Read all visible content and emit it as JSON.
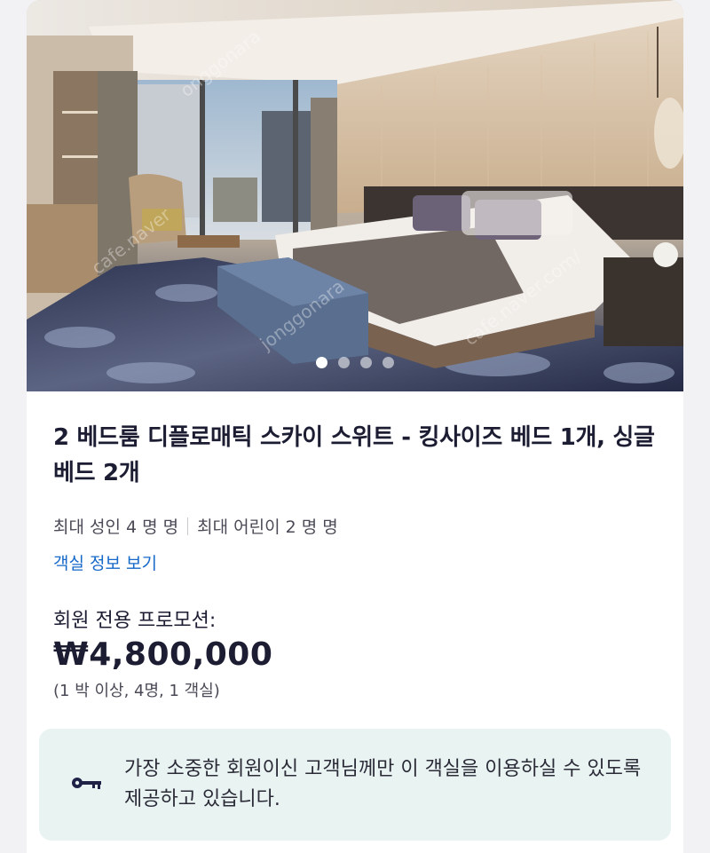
{
  "gallery": {
    "image_alt": "hotel-room-photo",
    "page_dots": 4,
    "active_index": 0
  },
  "room": {
    "title": "2 베드룸 디플로매틱 스카이 스위트 - 킹사이즈 베드 1개, 싱글 베드 2개",
    "max_adults": "최대 성인 4 명 명",
    "max_children": "최대 어린이 2 명 명",
    "details_link": "객실 정보 보기"
  },
  "pricing": {
    "promo_label": "회원 전용 프로모션:",
    "price": "₩4,800,000",
    "note": "(1 박 이상, 4명, 1 객실)"
  },
  "notice": {
    "icon": "key-icon",
    "text": "가장 소중한 회원이신 고객님께만 이 객실을 이용하실 수 있도록 제공하고 있습니다."
  },
  "colors": {
    "title_text": "#1c1d33",
    "link": "#1668c9",
    "notice_bg": "#e8f3f2",
    "key_icon": "#1f2147"
  }
}
